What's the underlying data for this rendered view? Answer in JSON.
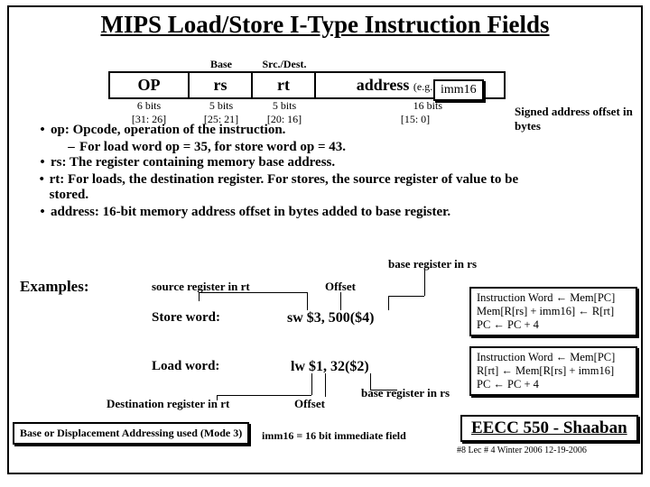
{
  "title": "MIPS Load/Store I-Type Instruction Fields",
  "top_labels": {
    "base": "Base",
    "srcDest": "Src./Dest."
  },
  "fields": {
    "op": {
      "name": "OP",
      "bits": "6 bits",
      "range": "[31: 26]"
    },
    "rs": {
      "name": "rs",
      "bits": "5 bits",
      "range": "[25: 21]"
    },
    "rt": {
      "name": "rt",
      "bits": "5 bits",
      "range": "[20: 16]"
    },
    "addr": {
      "name": "address",
      "note": "(e.g. offset)",
      "bits": "16  bits",
      "range": "[15: 0]"
    }
  },
  "imm_box": "imm16",
  "side_note": "Signed address offset in bytes",
  "bullets": {
    "b1": "op: Opcode, operation of the instruction.",
    "b1s": "For load word op = 35,  for store word op = 43.",
    "b2": "rs: The register containing memory base address.",
    "b3": "rt: For loads, the destination register.  For stores, the source register of value to be stored.",
    "b4": "address:  16-bit memory address offset in bytes added to base register."
  },
  "examples_label": "Examples:",
  "anno": {
    "src_reg": "source register in rt",
    "offset1": "Offset",
    "base_reg1": "base register in rs",
    "store": "Store word:",
    "load": "Load word:",
    "dest_reg": "Destination register in rt",
    "offset2": "Offset",
    "base_reg2": "base register in rs"
  },
  "code": {
    "sw": "sw $3, 500($4)",
    "lw": "lw $1, 32($2)"
  },
  "boxes": {
    "sw1": "Instruction Word  ←   Mem[PC]",
    "sw2": "Mem[R[rs] + imm16]  ←  R[rt]",
    "sw3": "PC  ←  PC + 4",
    "lw1": "Instruction Word  ←   Mem[PC]",
    "lw2": "R[rt]  ←   Mem[R[rs] + imm16]",
    "lw3": "PC  ←  PC + 4"
  },
  "foot_box": "Base or Displacement Addressing used (Mode 3)",
  "imm_note": "imm16 = 16 bit immediate field",
  "eecc": "EECC 550 - Shaaban",
  "page": "#8  Lec # 4    Winter 2006   12-19-2006"
}
